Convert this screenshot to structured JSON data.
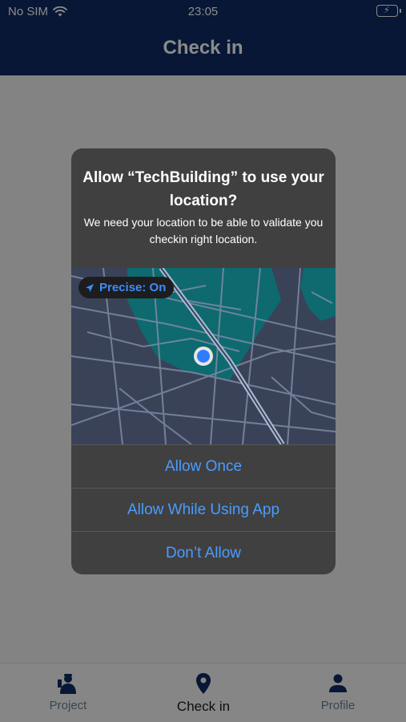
{
  "status_bar": {
    "carrier": "No SIM",
    "time": "23:05"
  },
  "header": {
    "title": "Check in"
  },
  "tabs": [
    {
      "label": "Project",
      "icon": "worker-icon"
    },
    {
      "label": "Check in",
      "icon": "location-pin-icon"
    },
    {
      "label": "Profile",
      "icon": "person-icon"
    }
  ],
  "alert": {
    "title": "Allow “TechBuilding” to use your location?",
    "message": "We need your location to be able to validate you checkin right location.",
    "precise_label": "Precise: On",
    "buttons": {
      "allow_once": "Allow Once",
      "allow_while_using": "Allow While Using App",
      "dont_allow": "Don’t Allow"
    }
  },
  "colors": {
    "header": "#0d2b63",
    "accent": "#4a9cff",
    "alert_bg": "#404040",
    "map_teal": "#0e6a6e"
  }
}
